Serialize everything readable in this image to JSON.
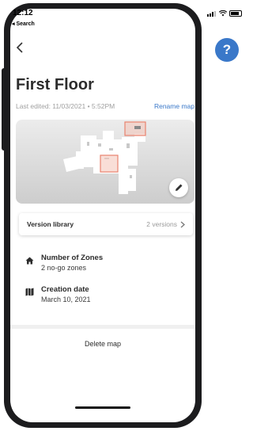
{
  "status_bar": {
    "time": "12:12",
    "back_app": "◂ Search"
  },
  "nav": {
    "back_icon": "chevron-left-icon",
    "help_label": "?"
  },
  "title": "First Floor",
  "last_edited": "Last edited: 11/03/2021 • 5:52PM",
  "rename_label": "Rename map",
  "map": {
    "edit_icon": "pencil-icon",
    "zone_color": "#e8836f",
    "floor_color": "#ffffff"
  },
  "version_library": {
    "label": "Version library",
    "count": "2 versions"
  },
  "zones": {
    "icon": "home-icon",
    "title": "Number of Zones",
    "value": "2 no-go zones"
  },
  "creation": {
    "icon": "map-icon",
    "title": "Creation date",
    "value": "March 10, 2021"
  },
  "delete_label": "Delete map",
  "colors": {
    "accent": "#3a78c9",
    "text": "#2c2c2c",
    "muted": "#a0a0a0"
  }
}
